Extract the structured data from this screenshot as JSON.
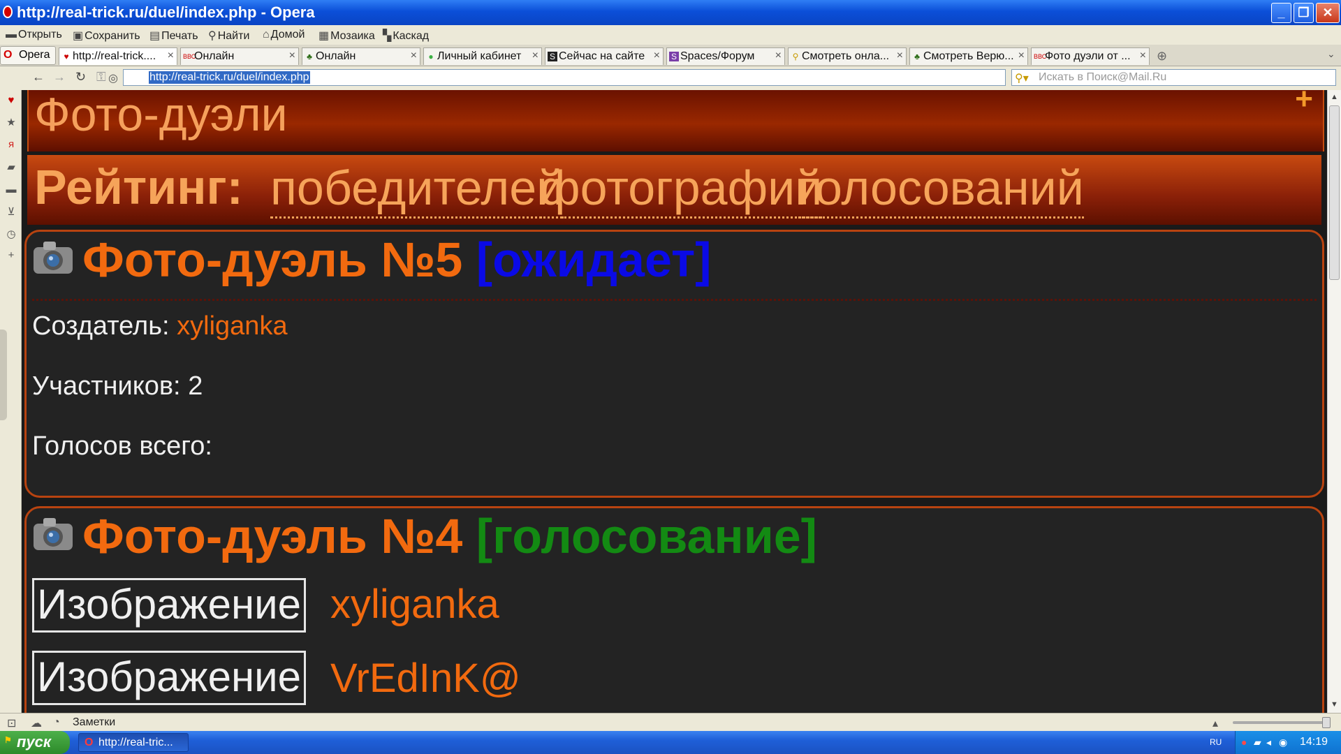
{
  "window": {
    "title": "http://real-trick.ru/duel/index.php - Opera"
  },
  "menu": {
    "items": [
      "Открыть",
      "Сохранить",
      "Печать",
      "Найти",
      "Домой",
      "Мозаика",
      "Каскад"
    ]
  },
  "tabs": {
    "opera_button": "Opera",
    "items": [
      {
        "label": "http://real-trick....",
        "icon": "heart"
      },
      {
        "label": "Онлайн",
        "icon": "bbc"
      },
      {
        "label": "Онлайн",
        "icon": "tree"
      },
      {
        "label": "Личный кабинет",
        "icon": "green-circle"
      },
      {
        "label": "Сейчас на сайте",
        "icon": "s-black"
      },
      {
        "label": "Spaces/Форум",
        "icon": "s-purple"
      },
      {
        "label": "Смотреть онла...",
        "icon": "search"
      },
      {
        "label": "Смотреть Верю...",
        "icon": "tree"
      },
      {
        "label": "Фото дуэли от ...",
        "icon": "bbc"
      }
    ]
  },
  "address": {
    "url": "http://real-trick.ru/duel/index.php",
    "search_placeholder": "Искать в Поиск@Mail.Ru"
  },
  "page": {
    "header_title": "Фото-дуэли",
    "rating_label": "Рейтинг:",
    "rating_links": [
      "победителей",
      "фотографий",
      "голосований"
    ],
    "duels": [
      {
        "title": "Фото-дуэль №5",
        "status": "[ожидает]",
        "creator_label": "Создатель:",
        "creator": "xyliganka",
        "participants_label": "Участников:",
        "participants": "2",
        "votes_label": "Голосов всего:"
      },
      {
        "title": "Фото-дуэль №4",
        "status": "[голосование]",
        "entries": [
          {
            "image_alt": "Изображение",
            "user": "xyliganka"
          },
          {
            "image_alt": "Изображение",
            "user": "VrEdInK@"
          }
        ]
      }
    ]
  },
  "statusbar": {
    "notes": "Заметки"
  },
  "taskbar": {
    "start": "пуск",
    "task": "http://real-tric...",
    "lang": "RU",
    "time": "14:19"
  },
  "colors": {
    "accent": "#f26a0f",
    "waiting": "#0a0ae6",
    "voting": "#138a13",
    "card_border": "#b84310"
  }
}
